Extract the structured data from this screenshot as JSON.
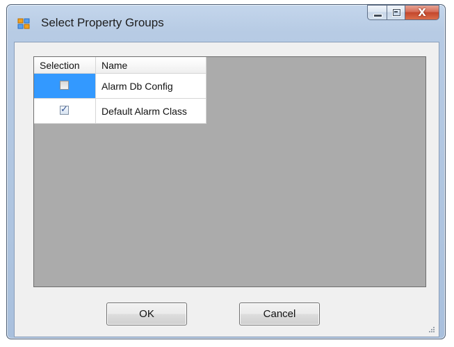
{
  "window": {
    "title": "Select Property Groups",
    "icon": "window-app-icon",
    "caption_buttons": {
      "minimize_icon": "minimize-icon",
      "maximize_icon": "maximize-icon",
      "close_icon": "close-icon",
      "close_glyph": "X"
    }
  },
  "grid": {
    "columns": [
      "Selection",
      "Name"
    ],
    "rows": [
      {
        "selected": false,
        "name": "Alarm Db Config",
        "selection_cell_highlighted": true
      },
      {
        "selected": true,
        "name": "Default Alarm Class",
        "selection_cell_highlighted": false
      }
    ]
  },
  "buttons": {
    "ok": "OK",
    "cancel": "Cancel"
  },
  "colors": {
    "grid_background": "#ababab",
    "selection_highlight": "#3399ff",
    "dialog_background": "#f0f0f0"
  }
}
